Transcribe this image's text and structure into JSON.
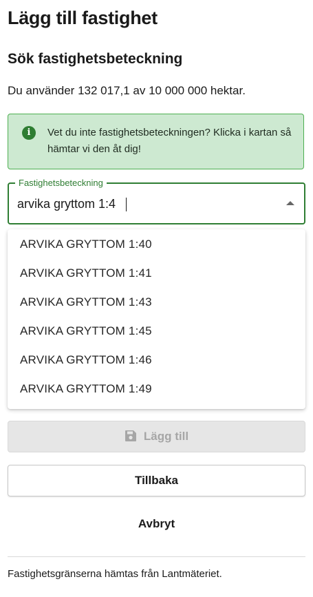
{
  "page": {
    "title": "Lägg till fastighet",
    "section_title": "Sök fastighetsbeteckning",
    "usage_text": "Du använder 132 017,1 av 10 000 000 hektar."
  },
  "info": {
    "icon": "info-icon",
    "text": "Vet du inte fastighetsbeteckningen? Klicka i kartan så hämtar vi den åt dig!"
  },
  "search": {
    "label": "Fastighetsbeteckning",
    "value": "arvika gryttom 1:4"
  },
  "dropdown": {
    "options": [
      "ARVIKA GRYTTOM 1:40",
      "ARVIKA GRYTTOM 1:41",
      "ARVIKA GRYTTOM 1:43",
      "ARVIKA GRYTTOM 1:45",
      "ARVIKA GRYTTOM 1:46",
      "ARVIKA GRYTTOM 1:49"
    ]
  },
  "actions": {
    "add_label": "Lägg till",
    "back_label": "Tillbaka",
    "cancel_label": "Avbryt"
  },
  "footer": {
    "text": "Fastighetsgränserna hämtas från Lantmäteriet."
  },
  "colors": {
    "accent": "#2e7d32",
    "info_bg": "#cde9d1",
    "disabled_bg": "#e6e6e6"
  }
}
